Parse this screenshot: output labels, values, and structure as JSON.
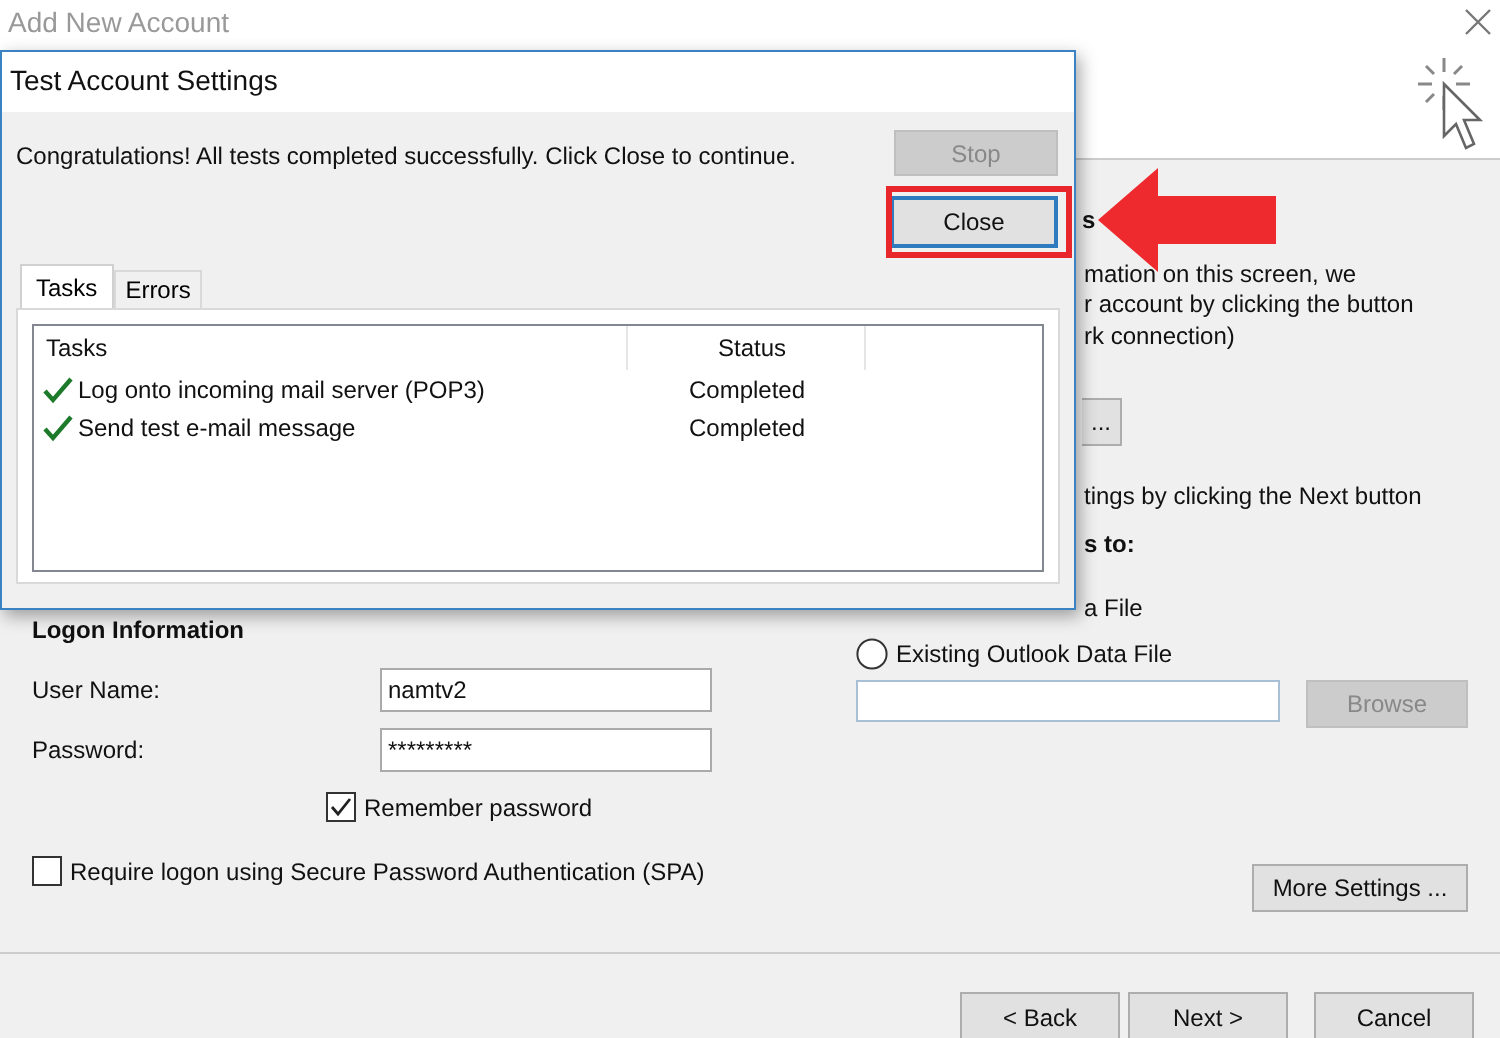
{
  "window": {
    "title": "Add New Account"
  },
  "logon": {
    "heading": "Logon Information",
    "user_name_label": "User Name:",
    "user_name": "namtv2",
    "password_label": "Password:",
    "password": "*********",
    "remember": {
      "label": "Remember password",
      "checked": true
    },
    "spa": {
      "label": "Require logon using Secure Password Authentication (SPA)",
      "checked": false
    }
  },
  "right_panel": {
    "heading_fragment": "s",
    "lines": [
      "mation on this screen, we",
      "r account by clicking the button",
      "rk connection)"
    ],
    "test_button": "...",
    "next_hint": "tings by clicking the Next button",
    "deliver_heading": "s to:",
    "option_fragment": "a File",
    "option": {
      "label": "Existing Outlook Data File",
      "selected": false
    },
    "browse_button": {
      "label": "Browse",
      "disabled": true
    },
    "more_settings": "More Settings ..."
  },
  "footer": {
    "buttons": [
      "< Back",
      "Next >",
      "Cancel"
    ]
  },
  "dialog": {
    "title": "Test Account Settings",
    "message": "Congratulations! All tests completed successfully. Click Close to continue.",
    "stop": {
      "label": "Stop",
      "disabled": true
    },
    "close": {
      "label": "Close",
      "highlighted": true
    },
    "tabs": [
      {
        "label": "Tasks",
        "selected": true
      },
      {
        "label": "Errors",
        "selected": false
      }
    ],
    "columns": [
      "Tasks",
      "Status"
    ],
    "rows": [
      {
        "task": "Log onto incoming mail server (POP3)",
        "status": "Completed",
        "done": true
      },
      {
        "task": "Send test e-mail message",
        "status": "Completed",
        "done": true
      }
    ]
  }
}
